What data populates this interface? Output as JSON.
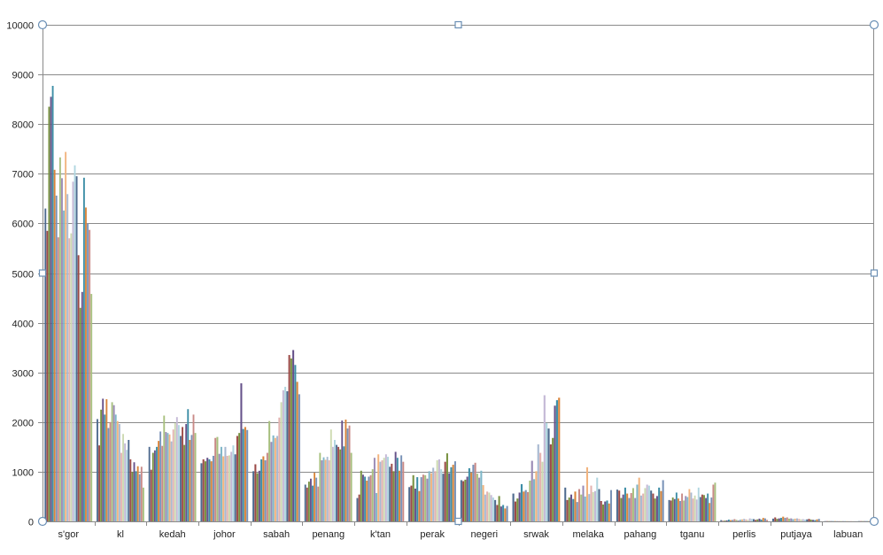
{
  "chart_data": {
    "type": "bar",
    "title": "",
    "xlabel": "",
    "ylabel": "",
    "ylim": [
      0,
      10000
    ],
    "yticks": [
      0,
      1000,
      2000,
      3000,
      4000,
      5000,
      6000,
      7000,
      8000,
      9000,
      10000
    ],
    "grid": true,
    "legend": "none",
    "categories": [
      "s'gor",
      "kl",
      "kedah",
      "johor",
      "sabah",
      "penang",
      "k'tan",
      "perak",
      "negeri",
      "srwak",
      "melaka",
      "pahang",
      "tganu",
      "perlis",
      "putjaya",
      "labuan"
    ],
    "palette": [
      "#4f6b8f",
      "#9c4a47",
      "#77913f",
      "#66528a",
      "#3d8ea6",
      "#d9853b",
      "#7a93b8",
      "#c98a87",
      "#a8c07f",
      "#9a8bb5",
      "#7fb7c8",
      "#f2b47f",
      "#a9b9d1",
      "#e3b3b1",
      "#cddab1",
      "#c4b9d6",
      "#b0d6e0"
    ],
    "values": [
      [
        6300,
        5850,
        8350,
        8550,
        8770,
        7080,
        6560,
        5720,
        7330,
        6910,
        6260,
        7440,
        6590,
        5700,
        5800,
        6840,
        7170,
        6950,
        5360,
        4300,
        4620,
        6920,
        6320,
        6000,
        5870,
        4580
      ],
      [
        2060,
        1530,
        2250,
        2470,
        2150,
        2460,
        1880,
        2000,
        2400,
        2340,
        2150,
        2020,
        1960,
        1380,
        1760,
        1570,
        1440,
        1640,
        1250,
        1000,
        1190,
        1010,
        1110,
        950,
        1100,
        680
      ],
      [
        1500,
        1040,
        1380,
        1430,
        1500,
        1620,
        1810,
        1520,
        2130,
        1800,
        1780,
        1750,
        1610,
        1850,
        1980,
        2100,
        1940,
        1720,
        1900,
        1540,
        1960,
        2260,
        1640,
        1740,
        2150,
        1780
      ],
      [
        1170,
        1250,
        1210,
        1280,
        1250,
        1210,
        1320,
        1680,
        1700,
        1360,
        1500,
        1310,
        1500,
        1320,
        1330,
        1400,
        1530,
        1350,
        1720,
        1780,
        2780,
        1860,
        1900,
        1840
      ],
      [
        1010,
        1150,
        970,
        1020,
        1250,
        1310,
        1230,
        1380,
        2020,
        1600,
        1730,
        1680,
        1720,
        2090,
        2400,
        2640,
        2710,
        2620,
        3350,
        3280,
        3450,
        3150,
        2810,
        2560
      ],
      [
        740,
        680,
        800,
        860,
        720,
        980,
        880,
        700,
        1380,
        1230,
        1290,
        1240,
        1300,
        1230,
        1850,
        1500,
        1640,
        1540,
        1500,
        1450,
        2030,
        1510,
        2050,
        1870,
        1930,
        1380
      ],
      [
        470,
        540,
        1020,
        940,
        900,
        820,
        900,
        930,
        1050,
        1280,
        570,
        1350,
        1200,
        1230,
        1280,
        1350,
        1300,
        1100,
        1160,
        1010,
        1400,
        1280,
        1020,
        1330,
        1200
      ],
      [
        690,
        720,
        930,
        660,
        890,
        610,
        890,
        940,
        930,
        860,
        1010,
        970,
        1080,
        1010,
        1230,
        1250,
        1050,
        960,
        1200,
        1370,
        970,
        1090,
        1140,
        1210
      ],
      [
        830,
        810,
        840,
        900,
        1070,
        980,
        1140,
        1180,
        960,
        880,
        1020,
        730,
        540,
        600,
        580,
        530,
        480,
        430,
        330,
        510,
        300,
        330,
        260,
        310
      ],
      [
        560,
        400,
        460,
        580,
        750,
        600,
        630,
        590,
        820,
        1220,
        850,
        1010,
        1550,
        1380,
        1200,
        2540,
        1980,
        1870,
        1550,
        1680,
        2330,
        2440,
        2490
      ],
      [
        680,
        430,
        480,
        540,
        450,
        600,
        390,
        650,
        540,
        720,
        500,
        1090,
        550,
        720,
        590,
        610,
        880,
        650,
        410,
        340,
        400,
        420,
        360,
        630
      ],
      [
        640,
        620,
        470,
        540,
        680,
        560,
        470,
        570,
        670,
        470,
        740,
        880,
        520,
        560,
        670,
        740,
        720,
        620,
        560,
        460,
        510,
        680,
        610,
        830
      ],
      [
        430,
        420,
        480,
        450,
        580,
        460,
        410,
        560,
        420,
        510,
        490,
        650,
        580,
        460,
        520,
        440,
        680,
        490,
        540,
        530,
        470,
        560,
        370,
        480,
        740,
        780
      ],
      [
        25,
        10,
        15,
        20,
        35,
        25,
        30,
        45,
        30,
        20,
        35,
        40,
        50,
        40,
        30,
        60,
        50,
        45,
        30,
        40,
        55,
        35,
        70,
        60,
        30
      ],
      [
        55,
        80,
        50,
        60,
        70,
        95,
        70,
        80,
        55,
        60,
        45,
        55,
        60,
        50,
        40,
        45,
        35,
        40,
        50,
        35,
        30,
        25,
        40,
        50
      ],
      [
        5,
        5,
        5,
        5,
        5,
        5,
        5,
        5,
        5,
        5,
        5,
        5,
        5,
        5,
        5,
        5,
        5,
        5,
        5,
        5,
        5,
        5,
        5,
        5
      ]
    ]
  }
}
